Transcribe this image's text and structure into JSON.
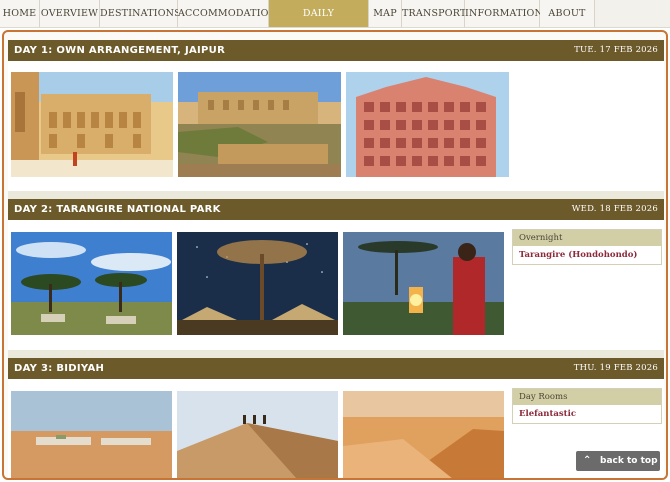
{
  "nav": {
    "items": [
      {
        "label": "HOME"
      },
      {
        "label": "OVERVIEW"
      },
      {
        "label": "DESTINATIONS"
      },
      {
        "label": "ACCOMMODATION"
      },
      {
        "label": "DAILY INFORMATION",
        "active": true
      },
      {
        "label": "MAP"
      },
      {
        "label": "TRANSPORT"
      },
      {
        "label": "INFORMATION"
      },
      {
        "label": "ABOUT US"
      }
    ]
  },
  "days": [
    {
      "title": "DAY 1: OWN ARRANGEMENT, JAIPUR",
      "date": "TUE. 17 FEB 2026",
      "photos": [
        "jaipur-palace-courtyard",
        "amber-fort",
        "hawa-mahal"
      ]
    },
    {
      "title": "DAY 2: TARANGIRE NATIONAL PARK",
      "date": "WED. 18 FEB 2026",
      "photos": [
        "acacia-savanna-camp",
        "night-sky-tented-camp",
        "maasai-lantern"
      ],
      "info": {
        "heading": "Overnight",
        "link": "Tarangire (Hondohondo)"
      }
    },
    {
      "title": "DAY 3: BIDIYAH",
      "date": "THU. 19 FEB 2026",
      "photos": [
        "desert-village",
        "dune-riders",
        "sand-dunes-sunset"
      ],
      "info": {
        "heading": "Day Rooms",
        "link": "Elefantastic"
      }
    }
  ],
  "back_to_top": {
    "label": "back to top",
    "icon": "chevron-up-icon"
  },
  "colors": {
    "header": "#6d5a2b",
    "active_nav": "#c3ad5c",
    "frame": "#c87435",
    "link": "#8b2a3a"
  }
}
